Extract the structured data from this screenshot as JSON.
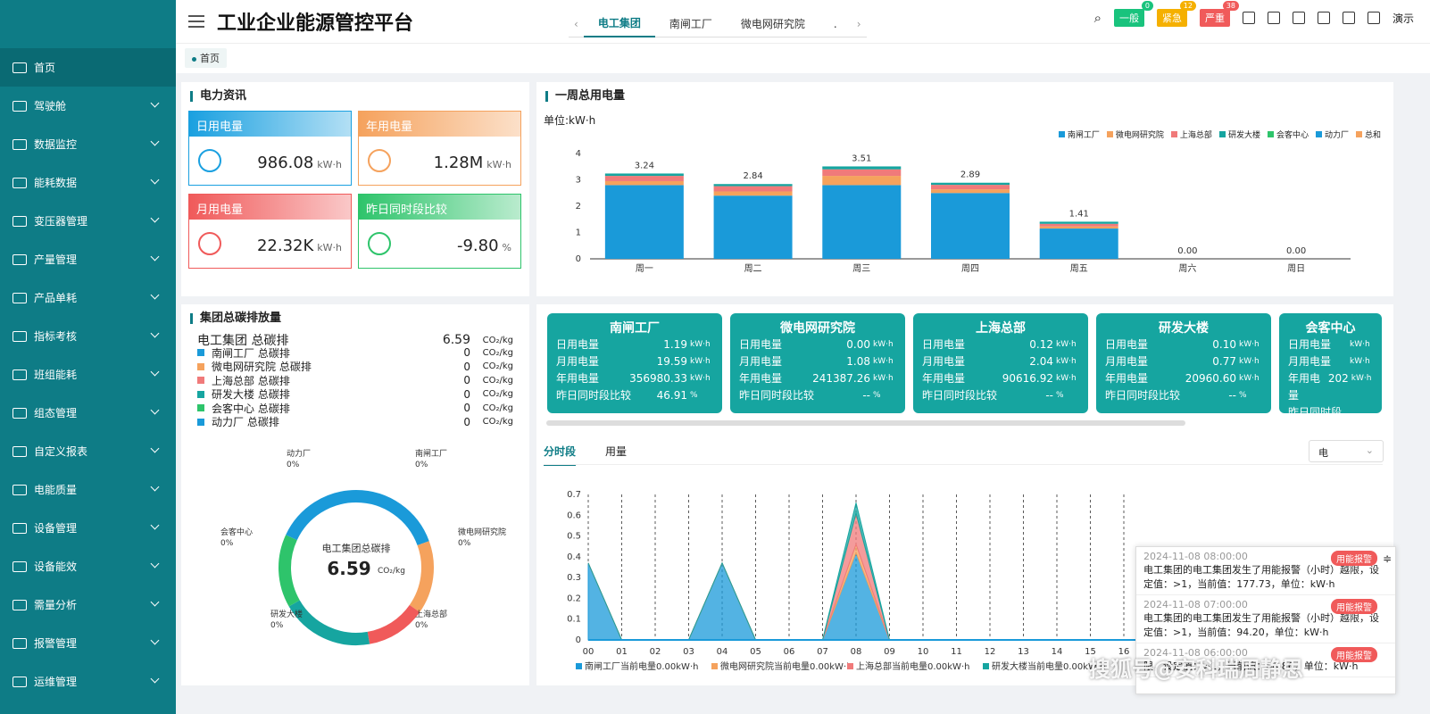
{
  "app": {
    "title": "工业企业能源管控平台"
  },
  "tabs": {
    "items": [
      "电工集团",
      "南闸工厂",
      "微电网研究院",
      "."
    ]
  },
  "header": {
    "badges": [
      {
        "label": "一般",
        "count": "0",
        "color": "#19c37d"
      },
      {
        "label": "紧急",
        "count": "12",
        "color": "#f5b000"
      },
      {
        "label": "严重",
        "count": "38",
        "color": "#f05a5a"
      }
    ],
    "demo": "演示"
  },
  "breadcrumb": "首页",
  "sidebar": {
    "items": [
      "首页",
      "驾驶舱",
      "数据监控",
      "能耗数据",
      "变压器管理",
      "产量管理",
      "产品单耗",
      "指标考核",
      "班组能耗",
      "组态管理",
      "自定义报表",
      "电能质量",
      "设备管理",
      "设备能效",
      "需量分析",
      "报警管理",
      "运维管理"
    ]
  },
  "power_info": {
    "title": "电力资讯",
    "cards": [
      {
        "label": "日用电量",
        "value": "986.08",
        "unit": "kW·h",
        "color": "#1aa0e0"
      },
      {
        "label": "年用电量",
        "value": "1.28M",
        "unit": "kW·h",
        "color": "#f5a25d"
      },
      {
        "label": "月用电量",
        "value": "22.32K",
        "unit": "kW·h",
        "color": "#f05a5a"
      },
      {
        "label": "昨日同时段比较",
        "value": "-9.80",
        "unit": "%",
        "color": "#2ec46b"
      }
    ]
  },
  "weekly": {
    "title": "一周总用电量",
    "unit": "单位:kW·h",
    "legend": [
      "南闸工厂",
      "微电网研究院",
      "上海总部",
      "研发大楼",
      "会客中心",
      "动力厂",
      "总和"
    ]
  },
  "chart_data": [
    {
      "type": "bar",
      "title": "一周总用电量",
      "categories": [
        "周一",
        "周二",
        "周三",
        "周四",
        "周五",
        "周六",
        "周日"
      ],
      "totals": [
        3.24,
        2.84,
        3.51,
        2.89,
        1.41,
        0.0,
        0.0
      ],
      "ylim": [
        0,
        4
      ],
      "yticks": [
        0,
        1,
        2,
        3,
        4
      ],
      "series": [
        {
          "name": "南闸工厂",
          "color": "#1a9ad9",
          "values": [
            2.8,
            2.4,
            2.8,
            2.5,
            1.15,
            0,
            0
          ]
        },
        {
          "name": "微电网研究院",
          "color": "#f5a25d",
          "values": [
            0.15,
            0.16,
            0.35,
            0.14,
            0.08,
            0,
            0
          ]
        },
        {
          "name": "上海总部",
          "color": "#f07a7a",
          "values": [
            0.2,
            0.2,
            0.25,
            0.17,
            0.1,
            0,
            0
          ]
        },
        {
          "name": "研发大楼",
          "color": "#16a5a0",
          "values": [
            0.09,
            0.08,
            0.11,
            0.08,
            0.08,
            0,
            0
          ]
        }
      ]
    },
    {
      "type": "area",
      "categories": [
        "00",
        "01",
        "02",
        "03",
        "04",
        "05",
        "06",
        "07",
        "08",
        "09",
        "10",
        "11",
        "12",
        "13",
        "14",
        "15",
        "16"
      ],
      "ylim": [
        0,
        0.7
      ],
      "yticks": [
        0,
        0.1,
        0.2,
        0.3,
        0.4,
        0.5,
        0.6,
        0.7
      ],
      "series": [
        {
          "name": "南闸工厂当前电量0.00kW·h",
          "color": "#1a9ad9",
          "values": [
            0.37,
            0,
            0,
            0,
            0.37,
            0,
            0,
            0,
            0.42,
            0,
            0,
            0,
            0,
            0,
            0,
            0,
            0
          ]
        },
        {
          "name": "微电网研究院当前电量0.00kW·h",
          "color": "#f5a25d",
          "values": [
            0,
            0,
            0,
            0,
            0,
            0,
            0,
            0,
            0.04,
            0,
            0,
            0,
            0,
            0,
            0,
            0,
            0
          ]
        },
        {
          "name": "上海总部当前电量0.00kW·h",
          "color": "#f07a7a",
          "values": [
            0,
            0,
            0,
            0,
            0,
            0,
            0,
            0,
            0.15,
            0,
            0,
            0,
            0,
            0,
            0,
            0,
            0
          ]
        },
        {
          "name": "研发大楼当前电量0.00kW·h",
          "color": "#16a5a0",
          "values": [
            0,
            0,
            0,
            0,
            0,
            0,
            0,
            0,
            0.05,
            0,
            0,
            0,
            0,
            0,
            0,
            0,
            0
          ]
        }
      ]
    }
  ],
  "carbon": {
    "title": "集团总碳排放量",
    "rows": [
      {
        "name": "电工集团 总碳排",
        "value": "6.59",
        "unit": "CO₂/kg",
        "color": ""
      },
      {
        "name": "南闸工厂 总碳排",
        "value": "0",
        "unit": "CO₂/kg",
        "color": "#1a9ad9"
      },
      {
        "name": "微电网研究院 总碳排",
        "value": "0",
        "unit": "CO₂/kg",
        "color": "#f5a25d"
      },
      {
        "name": "上海总部 总碳排",
        "value": "0",
        "unit": "CO₂/kg",
        "color": "#f07a7a"
      },
      {
        "name": "研发大楼 总碳排",
        "value": "0",
        "unit": "CO₂/kg",
        "color": "#16a5a0"
      },
      {
        "name": "会客中心 总碳排",
        "value": "0",
        "unit": "CO₂/kg",
        "color": "#2ec46b"
      },
      {
        "name": "动力厂 总碳排",
        "value": "0",
        "unit": "CO₂/kg",
        "color": "#1a9ad9"
      }
    ],
    "center_label": "电工集团总碳排",
    "center_value": "6.59",
    "center_unit": "CO₂/kg",
    "donut_labels": [
      {
        "name": "动力厂",
        "pct": "0%"
      },
      {
        "name": "南闸工厂",
        "pct": "0%"
      },
      {
        "name": "微电网研究院",
        "pct": "0%"
      },
      {
        "name": "上海总部",
        "pct": "0%"
      },
      {
        "name": "研发大楼",
        "pct": "0%"
      },
      {
        "name": "会客中心",
        "pct": "0%"
      }
    ]
  },
  "plants": [
    {
      "name": "南闸工厂",
      "daily": "1.19",
      "monthly": "19.59",
      "yearly": "356980.33",
      "compare": "46.91",
      "cmp_unit": "%"
    },
    {
      "name": "微电网研究院",
      "daily": "0.00",
      "monthly": "1.08",
      "yearly": "241387.26",
      "compare": "--",
      "cmp_unit": "%"
    },
    {
      "name": "上海总部",
      "daily": "0.12",
      "monthly": "2.04",
      "yearly": "90616.92",
      "compare": "--",
      "cmp_unit": "%"
    },
    {
      "name": "研发大楼",
      "daily": "0.10",
      "monthly": "0.77",
      "yearly": "20960.60",
      "compare": "--",
      "cmp_unit": "%"
    },
    {
      "name": "会客中心",
      "daily": "",
      "monthly": "",
      "yearly": "202",
      "compare": "",
      "cmp_unit": ""
    }
  ],
  "plant_labels": {
    "daily": "日用电量",
    "monthly": "月用电量",
    "yearly": "年用电量",
    "compare": "昨日同时段比较",
    "unit": "kW·h"
  },
  "timeline": {
    "tabs": [
      "分时段",
      "用量"
    ],
    "select": "电"
  },
  "alarms": [
    {
      "time": "2024-11-08 08:00:00",
      "badge": "用能报警",
      "text": "电工集团的电工集团发生了用能报警（小时）越限，设定值：>1，当前值：177.73，单位：kW·h"
    },
    {
      "time": "2024-11-08 07:00:00",
      "badge": "用能报警",
      "text": "电工集团的电工集团发生了用能报警（小时）越限，设定值：>1，当前值：94.20，单位：kW·h"
    },
    {
      "time": "2024-11-08 06:00:00",
      "badge": "用能报警",
      "text": "限，设定值：>1，当前值：84.86，单位：kW·h"
    }
  ],
  "watermark": "搜狐号@安科瑞周静思"
}
